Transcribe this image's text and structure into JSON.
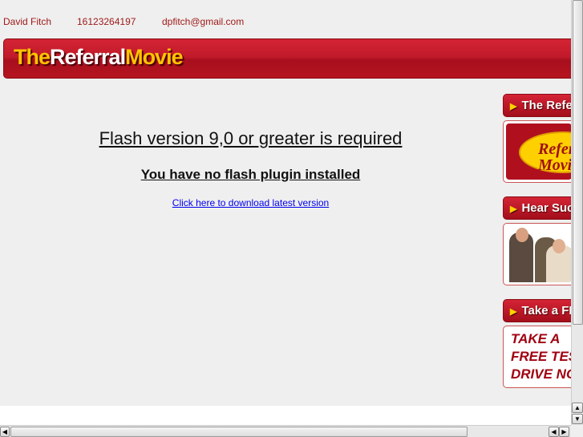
{
  "contact": {
    "name": "David Fitch",
    "phone": "16123264197",
    "email": "dpfitch@gmail.com"
  },
  "logo": {
    "part1": "The",
    "part2": "Referral",
    "part3": "Movie"
  },
  "main": {
    "heading": "Flash version 9,0 or greater is required",
    "subheading": "You have no flash plugin installed",
    "download_link": "Click here to download latest version"
  },
  "sidebar": [
    {
      "title": "The Referral Movie",
      "image_text": "Referral Movie"
    },
    {
      "title": "Hear Success Stories",
      "image_text": ""
    },
    {
      "title": "Take a FREE Test Drive",
      "image_text": "TAKE A FREE TEST DRIVE NOW"
    }
  ],
  "colors": {
    "brand_red": "#c11a2a",
    "brand_yellow": "#ffc400",
    "contact_text": "#a01a1a"
  }
}
